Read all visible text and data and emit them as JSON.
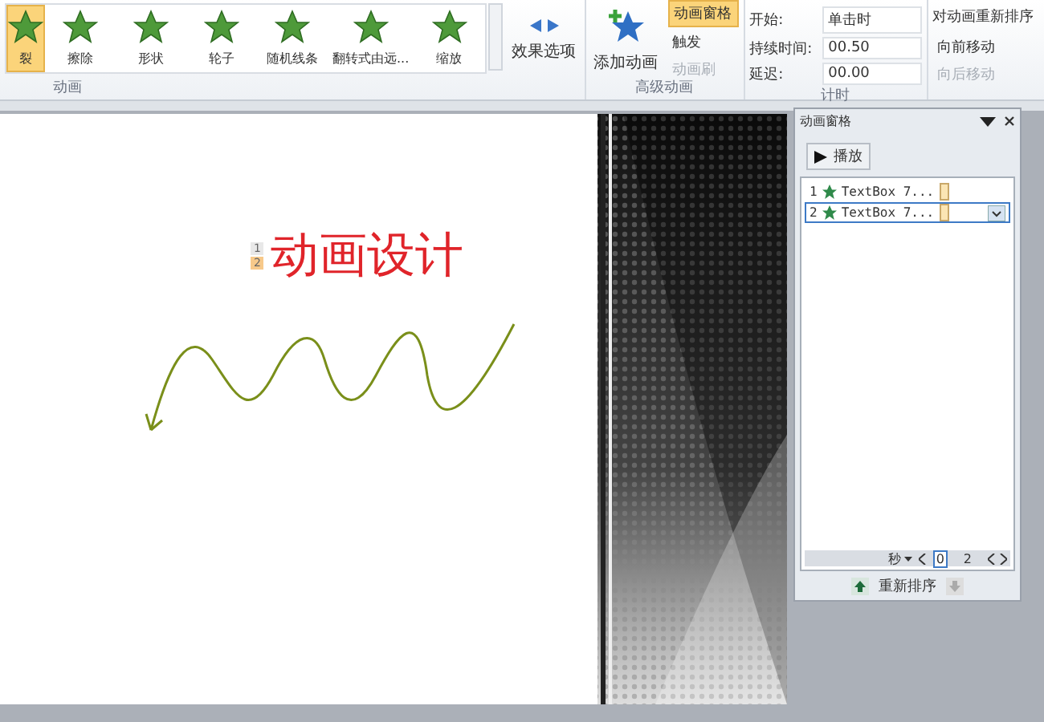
{
  "ribbon": {
    "effects": [
      {
        "label": "裂",
        "selected": true
      },
      {
        "label": "擦除",
        "selected": false
      },
      {
        "label": "形状",
        "selected": false
      },
      {
        "label": "轮子",
        "selected": false
      },
      {
        "label": "随机线条",
        "selected": false
      },
      {
        "label": "翻转式由远...",
        "selected": false
      },
      {
        "label": "缩放",
        "selected": false
      }
    ],
    "effects_group": "动画",
    "effect_options": "效果选项",
    "advanced": {
      "add": "添加动画",
      "pane": {
        "label": "动画窗格",
        "on": true
      },
      "trigger": {
        "label": "触发",
        "disabled": false
      },
      "painter": {
        "label": "动画刷",
        "disabled": true
      },
      "group": "高级动画"
    },
    "timing": {
      "start_label": "开始:",
      "start_value": "单击时",
      "duration_label": "持续时间:",
      "duration_value": "00.50",
      "delay_label": "延迟:",
      "delay_value": "00.00",
      "group": "计时"
    },
    "reorder": {
      "title": "对动画重新排序",
      "earlier": {
        "label": "向前移动",
        "disabled": false
      },
      "later": {
        "label": "向后移动",
        "disabled": true
      }
    }
  },
  "slide": {
    "tags": [
      {
        "label": "1",
        "selected": false
      },
      {
        "label": "2",
        "selected": true
      }
    ],
    "title": "动画设计"
  },
  "pane": {
    "title": "动画窗格",
    "play": "播放",
    "items": [
      {
        "number": "1",
        "name": "TextBox 7...",
        "selected": false
      },
      {
        "number": "2",
        "name": "TextBox 7...",
        "selected": true
      }
    ],
    "seconds": "秒",
    "zoom_start": "0",
    "zoom_end": "2",
    "reorder": "重新排序"
  }
}
